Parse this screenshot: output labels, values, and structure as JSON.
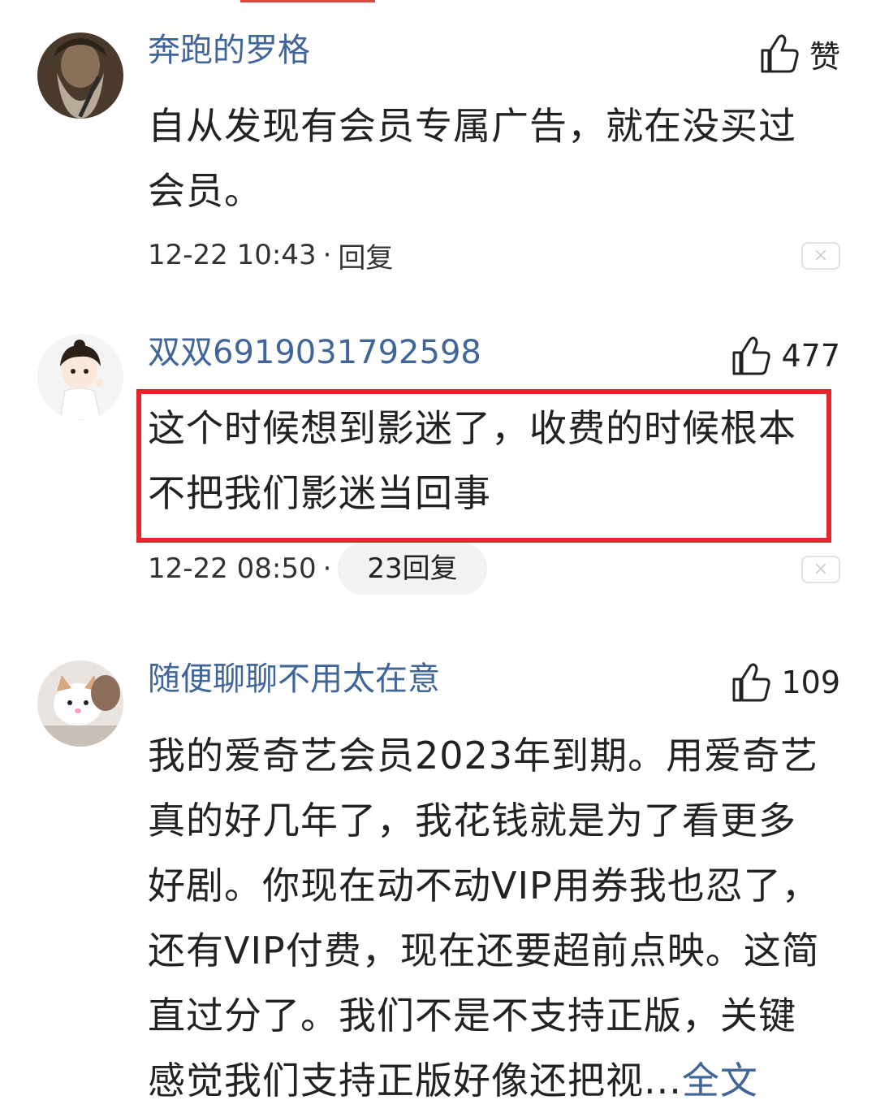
{
  "comments": [
    {
      "username": "奔跑的罗格",
      "like_label": "赞",
      "text_lines": [
        "自从发现有会员专属广告，就在没买过",
        "会员。"
      ],
      "timestamp": "12-22 10:43",
      "separator": "·",
      "reply_label": "回复",
      "close_symbol": "×"
    },
    {
      "username": "双双6919031792598",
      "like_label": "477",
      "text_lines": [
        "这个时候想到影迷了，收费的时候根本",
        "不把我们影迷当回事"
      ],
      "timestamp": "12-22 08:50",
      "separator": "·",
      "reply_label": "23回复",
      "close_symbol": "×"
    },
    {
      "username": "随便聊聊不用太在意",
      "like_label": "109",
      "text_lines": [
        "我的爱奇艺会员2023年到期。用爱奇艺",
        "真的好几年了，我花钱就是为了看更多",
        "好剧。你现在动不动VIP用券我也忍了，",
        "还有VIP付费，现在还要超前点映。这简",
        "直过分了。我们不是不支持正版，关键",
        "感觉我们支持正版好像还把视..."
      ],
      "more_label": "全文"
    }
  ],
  "colors": {
    "username": "#406599",
    "highlight_border": "#e5262a",
    "reply_pill_bg": "#f2f2f2"
  },
  "icons": {
    "like": "thumbs-up-icon",
    "close": "close-icon"
  }
}
